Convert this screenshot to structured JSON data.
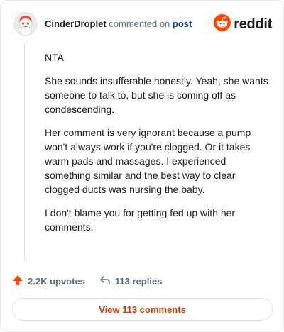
{
  "header": {
    "author": "CinderDroplet",
    "commented_text": "commented on",
    "post_link": "post",
    "logo_text": "reddit"
  },
  "comment": {
    "paragraphs": [
      "NTA",
      "She sounds insufferable honestly. Yeah, she wants someone to talk to, but she is coming off as condescending.",
      "Her comment is very ignorant because a pump won't always work if you're clogged. Or it takes warm pads and massages. I experienced something similar and the best way to clear clogged ducts was nursing the baby.",
      "I don't blame you for getting fed up with her comments."
    ]
  },
  "actions": {
    "upvotes": "2.2K upvotes",
    "replies": "113 replies"
  },
  "footer": {
    "view_button": "View 113 comments"
  },
  "colors": {
    "brand": "#ff4500",
    "accent": "#d93a00",
    "link": "#0a449b",
    "muted": "#576f76"
  },
  "icons": [
    "snoo-avatar-icon",
    "reddit-logo-icon",
    "upvote-arrow-icon",
    "reply-arrow-icon"
  ]
}
